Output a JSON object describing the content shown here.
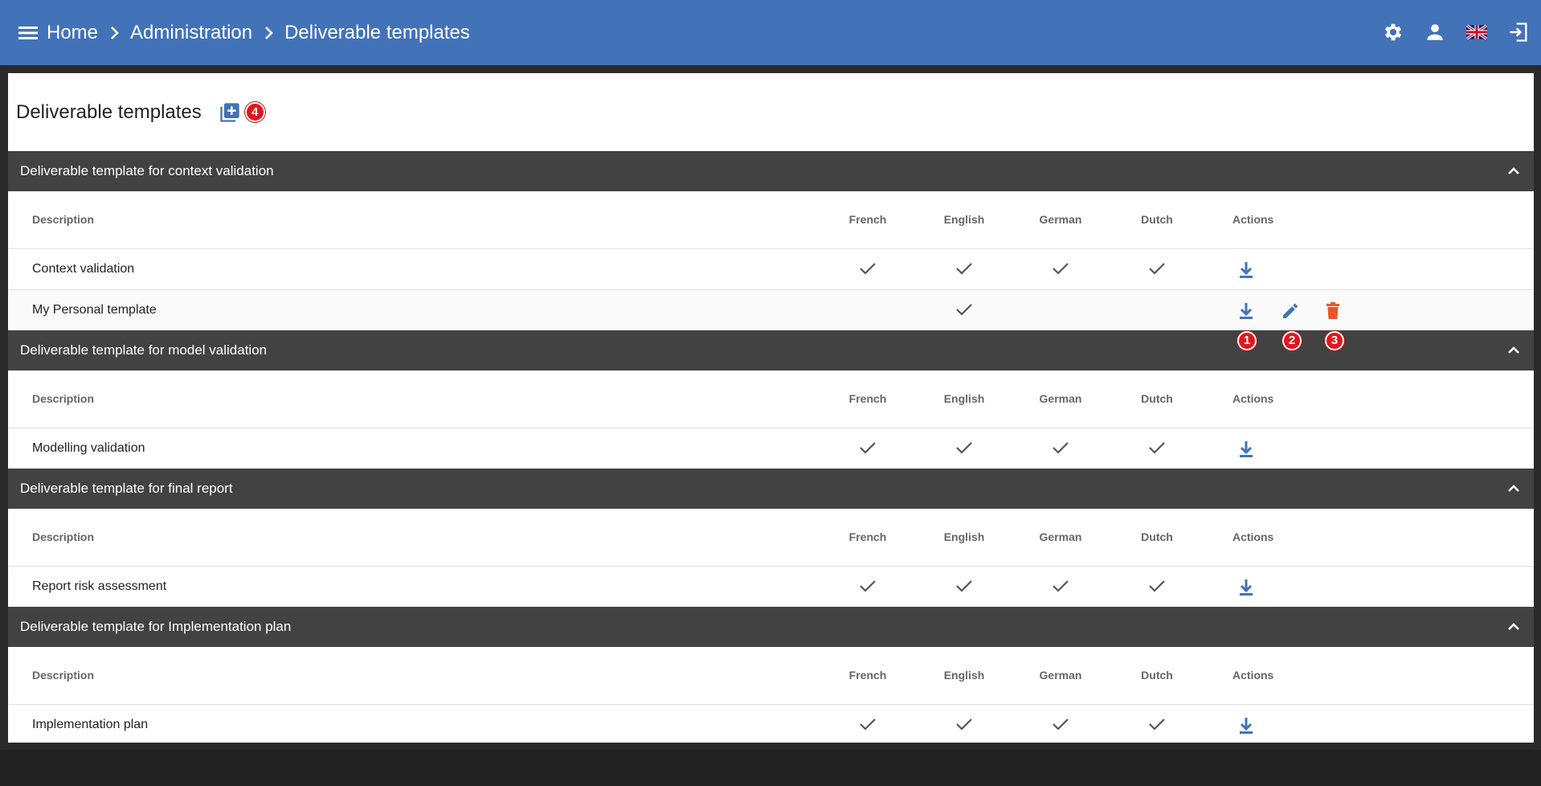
{
  "topbar": {
    "breadcrumbs": [
      "Home",
      "Administration",
      "Deliverable templates"
    ],
    "icons": [
      "menu-icon",
      "settings-icon",
      "user-icon",
      "uk-flag-icon",
      "logout-icon"
    ],
    "bg_color": "#4272b8"
  },
  "page": {
    "title": "Deliverable templates",
    "add_badge": "4"
  },
  "columns": {
    "description": "Description",
    "french": "French",
    "english": "English",
    "german": "German",
    "dutch": "Dutch",
    "actions": "Actions"
  },
  "sections": [
    {
      "title": "Deliverable template for context validation",
      "rows": [
        {
          "description": "Context validation",
          "french": true,
          "english": true,
          "german": true,
          "dutch": true,
          "actions": [
            "download"
          ]
        },
        {
          "description": "My Personal template",
          "french": false,
          "english": true,
          "german": false,
          "dutch": false,
          "actions": [
            "download",
            "edit",
            "delete"
          ]
        }
      ]
    },
    {
      "title": "Deliverable template for model validation",
      "rows": [
        {
          "description": "Modelling validation",
          "french": true,
          "english": true,
          "german": true,
          "dutch": true,
          "actions": [
            "download"
          ]
        }
      ]
    },
    {
      "title": "Deliverable template for final report",
      "rows": [
        {
          "description": "Report risk assessment",
          "french": true,
          "english": true,
          "german": true,
          "dutch": true,
          "actions": [
            "download"
          ]
        }
      ]
    },
    {
      "title": "Deliverable template for Implementation plan",
      "rows": [
        {
          "description": "Implementation plan",
          "french": true,
          "english": true,
          "german": true,
          "dutch": true,
          "actions": [
            "download"
          ]
        }
      ]
    }
  ],
  "step_badges": [
    "1",
    "2",
    "3"
  ],
  "colors": {
    "accent": "#4272b8",
    "delete": "#e8572a",
    "badge": "#e0171d",
    "section_header": "#424242"
  }
}
